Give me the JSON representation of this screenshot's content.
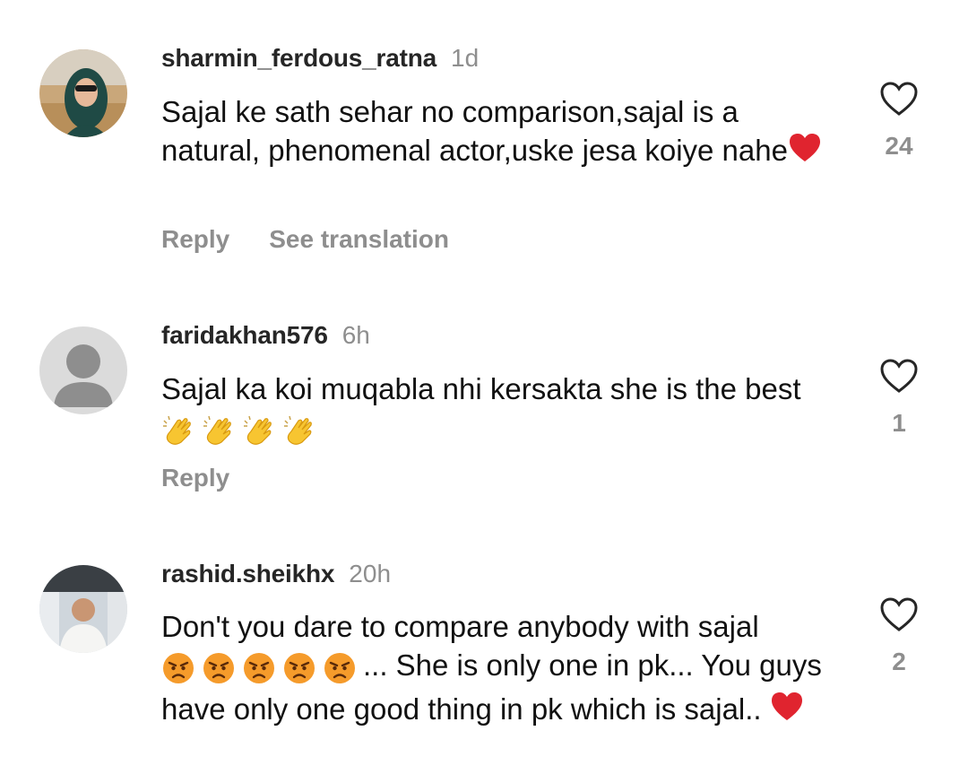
{
  "comments": [
    {
      "username": "sharmin_ferdous_ratna",
      "time": "1d",
      "text": "Sajal ke sath sehar  no comparison,sajal is a natural, phenomenal actor,uske jesa koiye nahe",
      "trailing_emoji": "red-heart-icon",
      "reply_label": "Reply",
      "translate_label": "See translation",
      "like_count": "24"
    },
    {
      "username": "faridakhan576",
      "time": "6h",
      "text": "Sajal ka koi muqabla nhi kersakta she is the best ",
      "trailing_emojis": [
        "clapping-hands-icon",
        "clapping-hands-icon",
        "clapping-hands-icon",
        "clapping-hands-icon"
      ],
      "reply_label": "Reply",
      "like_count": "1"
    },
    {
      "username": "rashid.sheikhx",
      "time": "20h",
      "text_before": "Don't you dare to compare anybody with sajal ",
      "middle_emojis": [
        "angry-face-icon",
        "angry-face-icon",
        "angry-face-icon",
        "angry-face-icon",
        "angry-face-icon"
      ],
      "text_after": "... She is only one in pk... You guys have only one good thing in pk which is sajal.. ",
      "trailing_emoji": "red-heart-icon",
      "like_count": "2"
    }
  ],
  "colors": {
    "text": "#111111",
    "username": "#262626",
    "muted": "#8e8e8e",
    "background": "#ffffff"
  }
}
